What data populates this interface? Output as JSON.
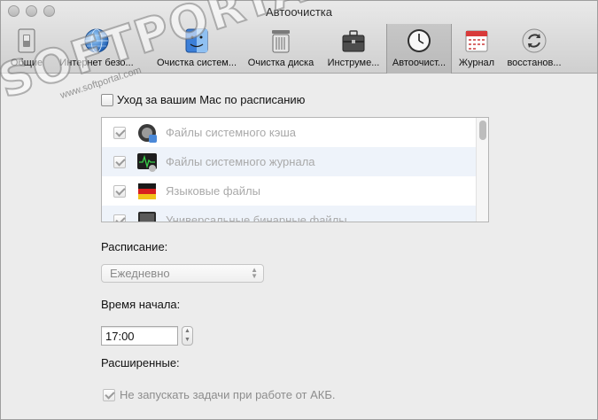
{
  "window": {
    "title": "Автоочистка"
  },
  "toolbar": {
    "items": [
      {
        "label": "Общие",
        "icon": "switch-icon"
      },
      {
        "label": "Интернет безо...",
        "icon": "globe-icon"
      },
      {
        "label": "Очистка систем...",
        "icon": "finder-icon"
      },
      {
        "label": "Очистка диска",
        "icon": "disk-cleaner-icon"
      },
      {
        "label": "Инструме...",
        "icon": "toolbox-icon"
      },
      {
        "label": "Автоочист...",
        "icon": "clock-icon",
        "selected": true
      },
      {
        "label": "Журнал",
        "icon": "calendar-icon"
      },
      {
        "label": "восстанов...",
        "icon": "restore-icon"
      }
    ]
  },
  "watermark": {
    "brand": "SOFTPORTAL",
    "url": "www.softportal.com"
  },
  "schedule": {
    "checkbox_label": "Уход за вашим Mac по расписанию",
    "checked": false
  },
  "tasks": [
    {
      "label": "Файлы системного кэша",
      "checked": true,
      "icon": "cache-icon"
    },
    {
      "label": "Файлы системного журнала",
      "checked": true,
      "icon": "log-icon"
    },
    {
      "label": "Языковые файлы",
      "checked": true,
      "icon": "flag-icon"
    },
    {
      "label": "Универсальные бинарные файлы",
      "checked": true,
      "icon": "binary-icon"
    }
  ],
  "schedule_section": {
    "label": "Расписание:",
    "selected": "Ежедневно"
  },
  "start_time": {
    "label": "Время начала:",
    "value": "17:00"
  },
  "advanced": {
    "label": "Расширенные:",
    "battery_option": "Не запускать задачи при работе от АКБ.",
    "battery_checked": true
  },
  "colors": {
    "window_bg": "#ececec",
    "toolbar_selected": "#bdbdbd",
    "disabled_text": "#a9a9a9"
  }
}
